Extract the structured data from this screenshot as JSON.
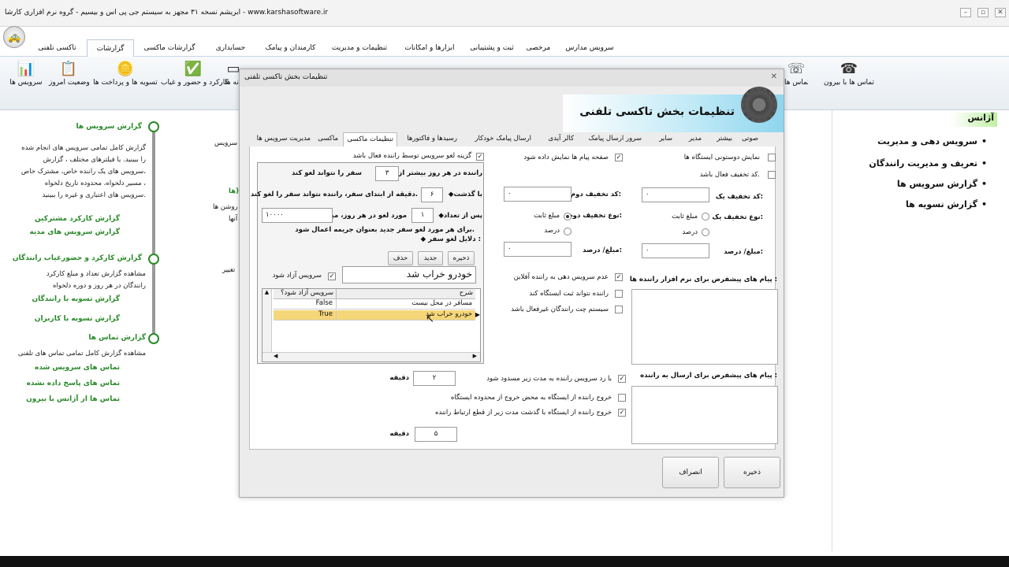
{
  "window": {
    "title": "ابریشم نسخه ۳۱ مجهز به سیستم جی پی اس و بیسیم - گروه نرم افزاری کارشا - www.karshasoftware.ir",
    "minimize": "–",
    "restore": "▫",
    "close": "✕"
  },
  "tabs": [
    "سرویس مدارس",
    "مرخصی",
    "ثبت و پشتیبانی",
    "ابزارها و امکانات",
    "تنظیمات و مدیریت",
    "کارمندان و پیامک",
    "حسابداری",
    "گزارشات ماکسی",
    "گزارشات",
    "تاکسی تلفنی"
  ],
  "ribbon": {
    "left": [
      "سرویس ها",
      "وضعیت امروز",
      "تسویه ها و پرداخت ها",
      "کارکرد و حضور و غیاب",
      "نه ها"
    ],
    "right": [
      "تماس ها با بیرون",
      "تماس ها"
    ]
  },
  "left_panel": {
    "groups": [
      {
        "title": "گزارش سرویس ها",
        "desc": [
          "گزارش کامل تمامی سرویس های انجام شده",
          "را ببینید. با فیلترهای مختلف ، گزارش",
          "سرویس های یک راننده خاص، مشترک خاص،",
          "مسیر دلخواه، محدوده تاریخ دلخواه ،",
          "سرویس های اعتباری و غیره را ببینید."
        ]
      },
      {
        "links": [
          "گزارش کارکرد مشترکین",
          "گزارش سرویس های مدیه"
        ]
      },
      {
        "title": "گزارش کارکرد و حضورغیاب رانندگان",
        "desc": [
          "مشاهده گزارش تعداد و مبلغ کارکرد",
          "رانندگان در هر روز و دوره دلخواه"
        ]
      },
      {
        "links": [
          "گزارش تسویه با رانندگان",
          "گزارش تسویه با کاربران"
        ]
      },
      {
        "title": "گزارش تماس ها",
        "desc": [
          "مشاهده گزارش کامل تمامی تماس های تلفنی"
        ]
      },
      {
        "links": [
          "تماس های سرویس شده",
          "تماس های پاسخ داده نشده",
          "تماس ها از آژانس با بیرون"
        ]
      }
    ]
  },
  "background_fragments": [
    "سرویس",
    "ها)",
    "روشن ها",
    "آنها",
    "تغییر"
  ],
  "right_panel": {
    "heading": "آژانس",
    "items": [
      "سرویس دهی و مدیریت",
      "تعریف و مدیریت رانندگان",
      "گزارش سرویس ها",
      "گزارش تسویه ها"
    ]
  },
  "dialog": {
    "title": "تنظیمات بخش تاکسی تلفنی",
    "banner_title": "تنظیمات بخش تاکسی تلفنی",
    "tabs": [
      "صوتی",
      "بیشتر",
      "مدیر",
      "سایر",
      "سرور ارسال پیامک",
      "کالر آیدی",
      "ارسال پیامک خودکار",
      "رسیدها و فاکتورها",
      "تنظیمات ماکسی",
      "ماکسی",
      "مدیریت سرویس ها"
    ],
    "active_tab": "تنظیمات ماکسی",
    "cancel_option": "گزینه لغو سرویس توسط راننده فعال باشد",
    "group": {
      "rule1_a": "◆راننده در هر روز بیشتر از",
      "rule1_val": "۳",
      "rule1_b": "سفر را نتواند لغو کند",
      "rule2_a": "◆با گذشت",
      "rule2_val": "۶",
      "rule2_b": "دقیقه از ابتدای سفر، راننده نتواند سفر را لغو کند.",
      "rule3_a": "◆پس از تعداد",
      "rule3_val": "۱",
      "rule3_b": "مورد لغو در هر روز، مبلغ",
      "rule3_amount": "۱۰۰۰۰",
      "rule3_c": "برای هر مورد لغو سفر جدید بعنوان جریمه اعمال شود.",
      "reasons_label": "◆ دلایل لغو سفر :",
      "btn_save": "ذخیره",
      "btn_new": "جدید",
      "btn_delete": "حذف",
      "reason_input": "خودرو خراب شد",
      "free_service": "سرویس آزاد شود",
      "grid_headers": [
        "شرح",
        "سرویس آزاد شود؟"
      ],
      "grid_rows": [
        {
          "desc": "مسافر در محل نیست",
          "free": "False"
        },
        {
          "desc": "خودرو خراب شد",
          "free": "True"
        }
      ]
    },
    "show_msgs": "صفحه پیام ها نمایش داده شود",
    "show_station": "نمایش دوستونی ایستگاه ها",
    "discount_active": "کد تخفیف فعال باشد.",
    "disc1_label": "کد تخفیف یک:",
    "disc1_value": "۰",
    "disc2_label": "کد تخفیف دوم:",
    "disc2_value": "۰",
    "type1_label": "نوع تخفیف یک:",
    "type2_label": "نوع تخفیف دوم:",
    "fixed": "مبلغ ثابت",
    "percent": "درصد",
    "amt1_label": "مبلغ/ درصد:",
    "amt1_value": "۰",
    "amt2_label": "مبلغ/ درصد:",
    "amt2_value": "۰",
    "opt_no_service_offline": "عدم سرویس دهی به راننده آفلاین",
    "opt_no_station": "راننده نتواند ثبت ایستگاه کند",
    "opt_chat_inactive": "سیستم چت رانندگان غیرفعال باشد",
    "driver_app_msgs": "پیام های پیشفرض برای نرم افزار راننده ها :",
    "send_msgs": "پیام های پیشفرض برای ارسال به راننده :",
    "block_reject": "با رد سرویس راننده به مدت زیر مسدود شود",
    "block_minutes": "۲",
    "minute": "دقیقه",
    "exit_station": "خروج راننده از ایستگاه به محض خروج از محدوده ایستگاه",
    "exit_timeout": "خروج راننده از ایستگاه با گذشت مدت زیر از قطع ارتباط راننده",
    "exit_minutes": "۵",
    "minute2": "دقیقه",
    "save": "ذخیره",
    "cancel": "انصراف"
  }
}
